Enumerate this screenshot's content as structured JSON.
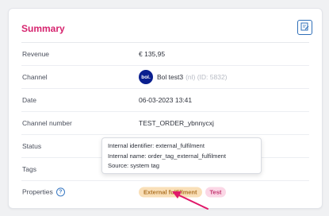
{
  "summary": {
    "title": "Summary",
    "edit_icon": "edit-icon",
    "rows": [
      {
        "label": "Revenue",
        "value": "€ 135,95"
      },
      {
        "label": "Channel",
        "logo": "bol.",
        "value": "Bol test3",
        "suffix": "(nl) (ID: 5832)"
      },
      {
        "label": "Date",
        "value": "06-03-2023 13:41"
      },
      {
        "label": "Channel number",
        "value": "TEST_ORDER_ybnnycxj"
      },
      {
        "label": "Status"
      },
      {
        "label": "Tags"
      },
      {
        "label": "Properties",
        "help_icon": "help-icon"
      }
    ],
    "properties_badges": [
      "External fulfillment",
      "Test"
    ]
  },
  "tooltip": {
    "line1": "Internal identifier: external_fulfilment",
    "line2": "Internal name: order_tag_external_fulfilment",
    "line3": "Source: system tag"
  },
  "colors": {
    "title": "#d6246e",
    "accent": "#2f6fb8",
    "arrow": "#e0196a",
    "badge_orange": "#f9dfb8",
    "badge_pink": "#fbd7e6"
  }
}
